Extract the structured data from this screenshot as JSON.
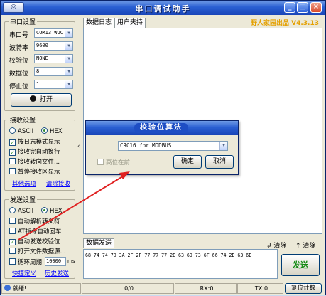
{
  "window": {
    "title": "串口调试助手",
    "system_menu": "◎",
    "brand": "野人家园出品 V4.3.13",
    "brand_color": "#e4a000"
  },
  "serial_settings": {
    "group_label": "串口设置",
    "port_label": "串口号",
    "port_value": "COM13 WUC",
    "baud_label": "波特率",
    "baud_value": "9600",
    "parity_label": "校验位",
    "parity_value": "NONE",
    "databits_label": "数据位",
    "databits_value": "8",
    "stopbits_label": "停止位",
    "stopbits_value": "1",
    "open_button": "打开"
  },
  "receive_settings": {
    "group_label": "接收设置",
    "ascii": "ASCII",
    "hex": "HEX",
    "options": [
      {
        "label": "按日志模式显示",
        "checked": true
      },
      {
        "label": "接收完自动换行",
        "checked": true
      },
      {
        "label": "接收转向文件...",
        "checked": false
      },
      {
        "label": "暂停接收区显示",
        "checked": false
      }
    ],
    "link_more": "其他选项",
    "link_clear": "清除接收"
  },
  "send_settings": {
    "group_label": "发送设置",
    "ascii": "ASCII",
    "hex": "HEX",
    "options": [
      {
        "label": "自动解析转义符",
        "checked": false
      },
      {
        "label": "AT指令自动回车",
        "checked": false
      },
      {
        "label": "自动发送校验位",
        "checked": true
      },
      {
        "label": "打开文件数据源...",
        "checked": false
      },
      {
        "label": "循环周期",
        "checked": false
      }
    ],
    "cycle_value": "10000",
    "cycle_unit": "ms",
    "link_shortcut": "快捷定义",
    "link_history": "历史发送"
  },
  "tabs": {
    "log": "数据日志",
    "user": "用户夹持"
  },
  "send_area": {
    "tab": "数据发送",
    "clear1": "清除",
    "clear2": "清除",
    "data": "68 74 74 70 3A 2F 2F 77 77 77 2E 63 6D 73 6F 66 74 2E 63 6E",
    "send_button": "发送"
  },
  "status": {
    "ready": "就绪!",
    "count": "0/0",
    "rx": "RX:0",
    "tx": "TX:0",
    "reset": "复位计数"
  },
  "dialog": {
    "title": "校验位算法",
    "algorithm": "CRC16 for MODBUS",
    "high_first": "高位在前",
    "ok": "确定",
    "cancel": "取消"
  }
}
